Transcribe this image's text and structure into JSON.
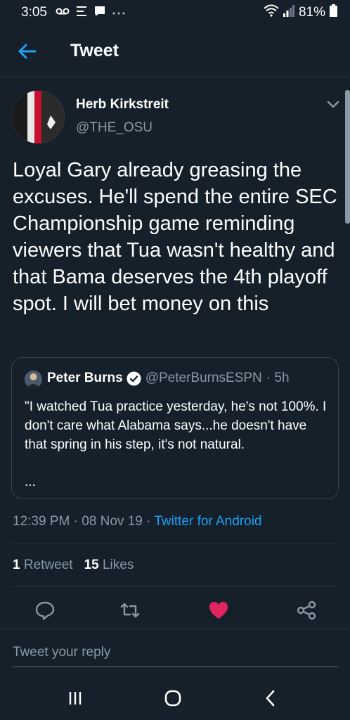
{
  "status_bar": {
    "time": "3:05",
    "icons_left": [
      "voicemail-icon",
      "notification-icon",
      "message-icon",
      "more-icon"
    ],
    "battery_percent": "81%"
  },
  "header": {
    "title": "Tweet",
    "back_icon": "arrow-left-icon"
  },
  "tweet": {
    "author_name": "Herb Kirkstreit",
    "author_handle": "@THE_OSU",
    "text": "Loyal Gary already greasing the excuses. He'll spend the entire SEC Championship game reminding viewers that Tua wasn't healthy and that Bama deserves the 4th playoff spot. I will bet money on this",
    "quoted": {
      "name": "Peter Burns",
      "handle": "@PeterBurnsESPN",
      "time": "· 5h",
      "text": "\"I watched Tua practice yesterday, he's not 100%. I don't care what Alabama says...he doesn't have that spring in his step, it's not natural.",
      "ellipsis": "..."
    },
    "time": "12:39 PM · 08 Nov 19 ·",
    "source": "Twitter for Android",
    "retweet_count": "1",
    "retweet_label": "Retweet",
    "like_count": "15",
    "like_label": "Likes"
  },
  "actions": [
    "reply-icon",
    "retweet-icon",
    "like-icon",
    "share-icon"
  ],
  "reply": {
    "placeholder": "Tweet your reply"
  },
  "colors": {
    "background": "#15202b",
    "accent": "#1da1f2",
    "like": "#e0245e",
    "secondary_text": "#8899a6"
  }
}
